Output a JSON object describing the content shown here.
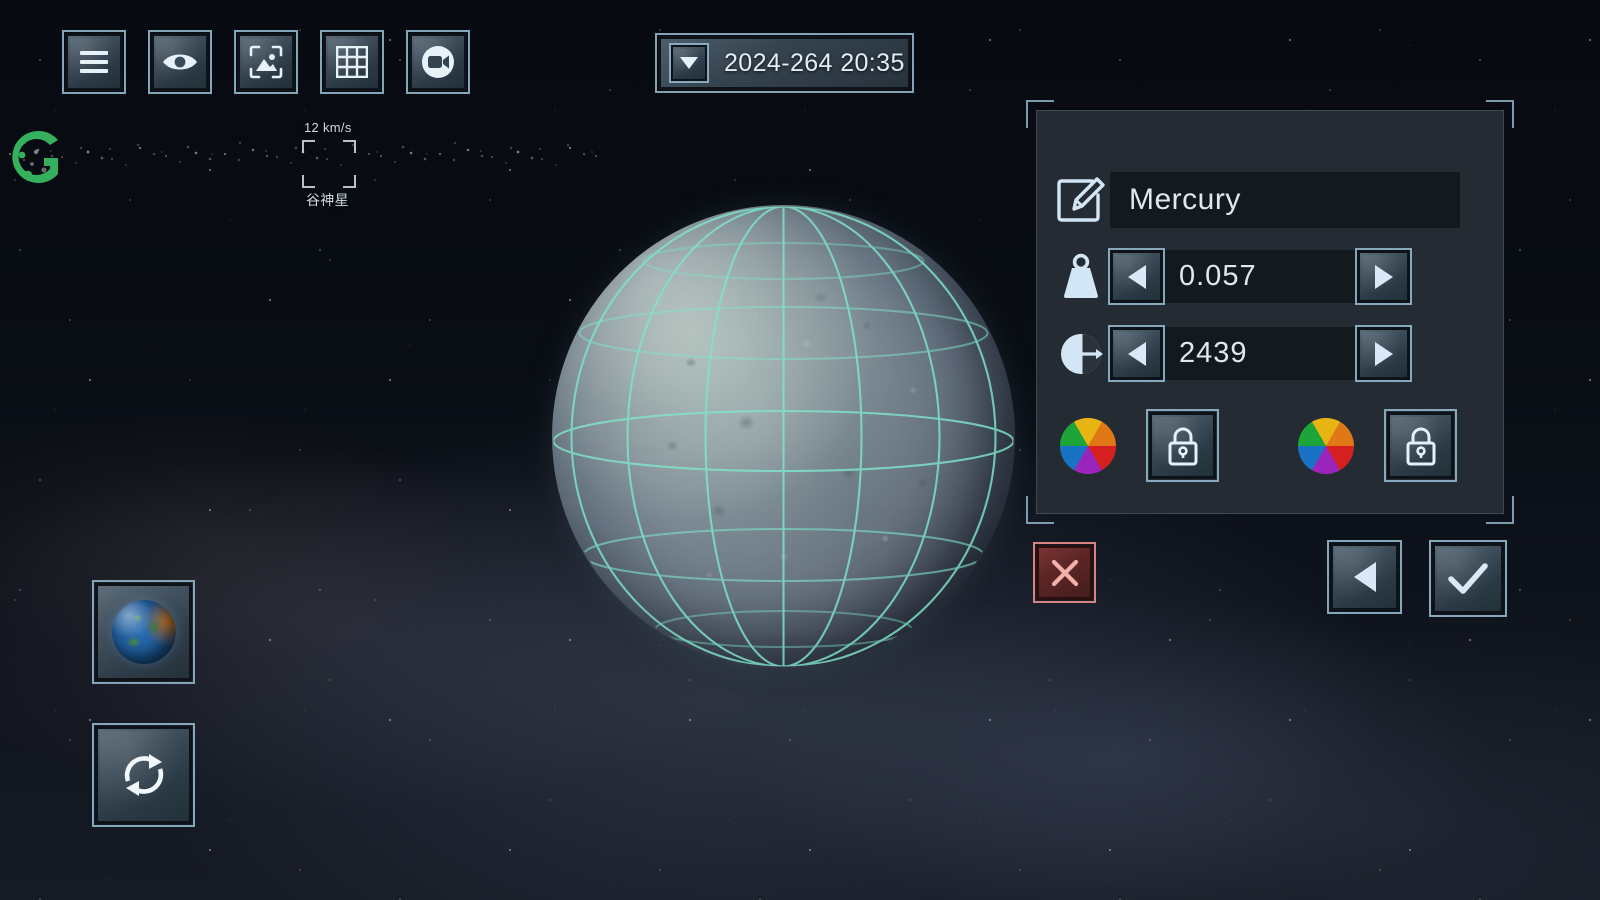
{
  "app": {
    "title": "Universe Sandbox — Planet Editor",
    "watermark": "G"
  },
  "colors": {
    "accent": "#8fb4c8",
    "panel_bg": "#242b33",
    "field_bg": "#14191e",
    "text": "#dce9f3",
    "danger": "#e08a84",
    "grid_overlay": "#7fe5cb"
  },
  "toolbar": {
    "items": [
      {
        "name": "menu-button",
        "icon": "hamburger-menu-icon"
      },
      {
        "name": "visibility-button",
        "icon": "eye-icon"
      },
      {
        "name": "screenshot-button",
        "icon": "image-capture-icon"
      },
      {
        "name": "grid-button",
        "icon": "grid-icon"
      },
      {
        "name": "record-button",
        "icon": "video-camera-icon"
      }
    ]
  },
  "date_bar": {
    "dropdown_icon": "chevron-down-icon",
    "value": "2024-264 20:35"
  },
  "scene": {
    "selected_object": {
      "name": "Mercury",
      "label_visible": false
    },
    "tracked_object": {
      "speed": "12 km/s",
      "label": "谷神星",
      "reticle": "selection-reticle"
    }
  },
  "left_dock": {
    "home_object_button": {
      "name": "earth-thumbnail-button",
      "icon": "earth-globe-icon"
    },
    "reset_button": {
      "name": "reset-view-button",
      "icon": "refresh-icon"
    }
  },
  "editor_panel": {
    "name_row": {
      "icon": "edit-pencil-icon",
      "label": "Name",
      "value": "Mercury",
      "placeholder": "Name"
    },
    "mass_row": {
      "icon": "mass-weight-icon",
      "label": "Mass",
      "value": "0.057",
      "decrement_icon": "triangle-left-icon",
      "increment_icon": "triangle-right-icon"
    },
    "radius_row": {
      "icon": "radius-icon",
      "label": "Radius",
      "value": "2439",
      "decrement_icon": "triangle-left-icon",
      "increment_icon": "triangle-right-icon"
    },
    "color_row": {
      "primary_swatch": {
        "name": "primary-color-wheel",
        "icon": "color-wheel-icon"
      },
      "primary_lock": {
        "name": "primary-color-lock-button",
        "icon": "lock-icon",
        "state": "locked"
      },
      "secondary_swatch": {
        "name": "secondary-color-wheel",
        "icon": "color-wheel-icon"
      },
      "secondary_lock": {
        "name": "secondary-color-lock-button",
        "icon": "lock-icon",
        "state": "locked"
      }
    }
  },
  "actions": {
    "close": {
      "name": "close-button",
      "icon": "close-x-icon"
    },
    "back": {
      "name": "back-button",
      "icon": "triangle-left-icon"
    },
    "accept": {
      "name": "accept-button",
      "icon": "checkmark-icon"
    }
  }
}
